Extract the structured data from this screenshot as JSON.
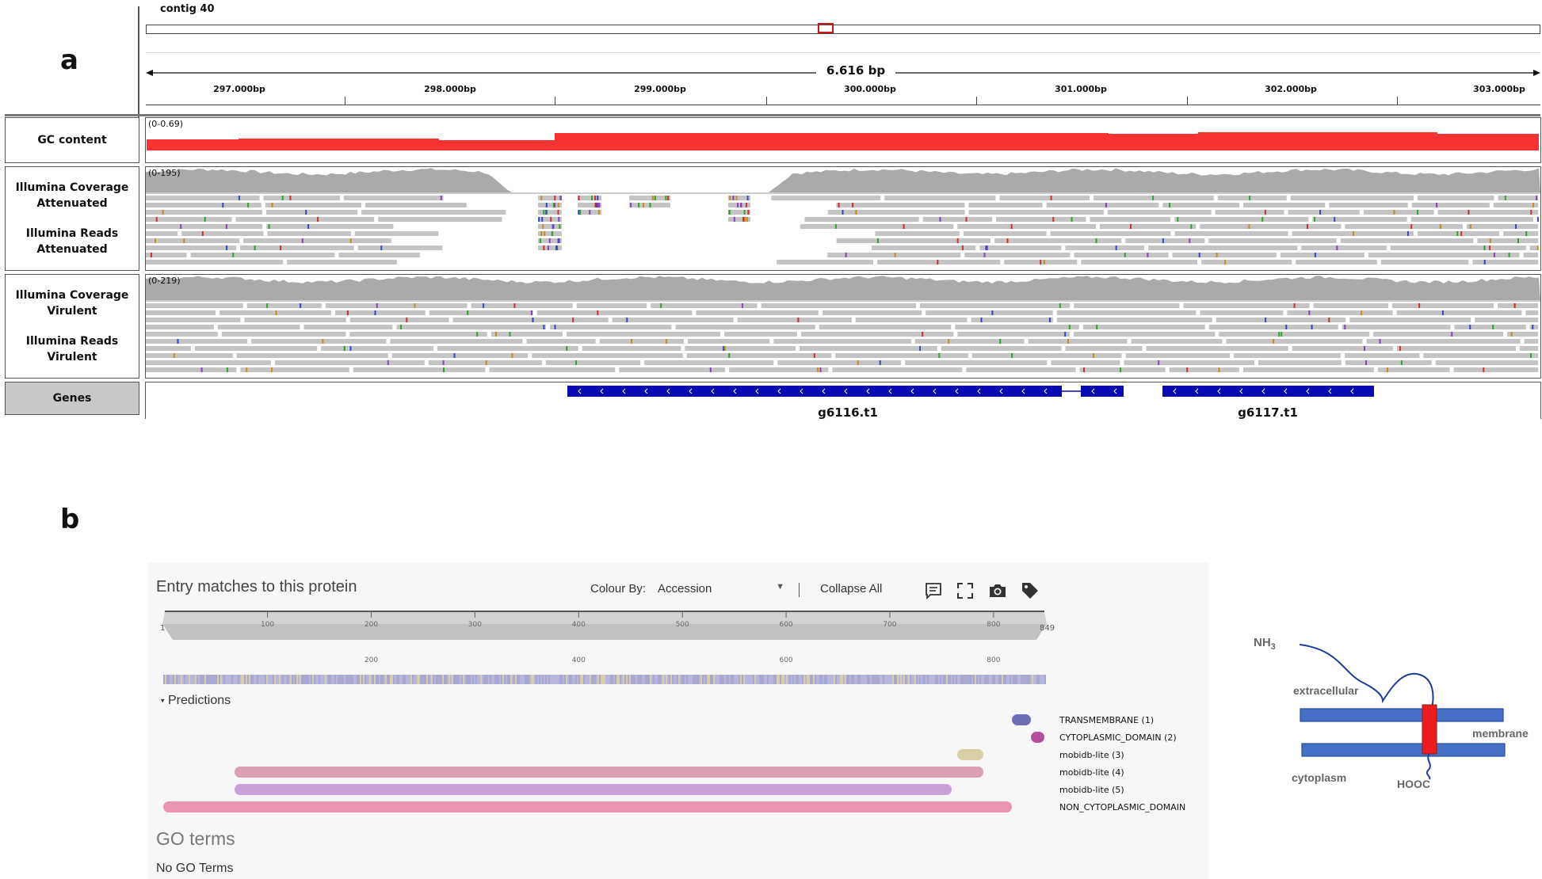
{
  "panel_a": {
    "letter": "a",
    "contig": "contig 40",
    "span": "6.616 bp",
    "ticks": [
      "297.000bp",
      "298.000bp",
      "299.000bp",
      "300.000bp",
      "301.000bp",
      "302.000bp",
      "303.000bp"
    ],
    "tracks": {
      "gc": {
        "label": "GC content",
        "range": "(0-0.69)"
      },
      "att_cov": {
        "label_line1": "Illumina Coverage",
        "label_line2": "Attenuated",
        "range": "(0-195)"
      },
      "att_reads": {
        "label_line1": "Illumina Reads",
        "label_line2": "Attenuated"
      },
      "vir_cov": {
        "label_line1": "Illumina Coverage",
        "label_line2": "Virulent",
        "range": "(0-219)"
      },
      "vir_reads": {
        "label_line1": "Illumina Reads",
        "label_line2": "Virulent"
      },
      "genes": {
        "label": "Genes",
        "gene1": "g6116.t1",
        "gene2": "g6117.t1"
      }
    },
    "colors": {
      "gc": "#f53333",
      "coverage": "#aaaaaa",
      "reads": "#c4c4c4",
      "gene": "#0a0ab4",
      "locator": "#d01515"
    }
  },
  "panel_b": {
    "letter": "b",
    "interpro": {
      "title": "Entry matches to this protein",
      "colour_by_label": "Colour By:",
      "colour_by_value": "Accession",
      "collapse_all": "Collapse All",
      "icons": [
        "comment-icon",
        "fullscreen-icon",
        "camera-icon",
        "tag-icon"
      ],
      "ruler_ticks": [
        "100",
        "200",
        "300",
        "400",
        "500",
        "600",
        "700",
        "800"
      ],
      "ruler_start": "1",
      "ruler_end": "849",
      "scale_ticks": [
        "200",
        "400",
        "600",
        "800"
      ],
      "section": "Predictions",
      "predictions": [
        {
          "label": "TRANSMEMBRANE (1)",
          "start": 818,
          "end": 836,
          "color": "#6e6db8"
        },
        {
          "label": "CYTOPLASMIC_DOMAIN (2)",
          "start": 836,
          "end": 849,
          "color": "#b4509e"
        },
        {
          "label": "mobidb-lite (3)",
          "start": 765,
          "end": 790,
          "color": "#d9cfa6"
        },
        {
          "label": "mobidb-lite (4)",
          "start": 70,
          "end": 790,
          "color": "#d9a1b2"
        },
        {
          "label": "mobidb-lite (5)",
          "start": 70,
          "end": 760,
          "color": "#c9a2dc"
        },
        {
          "label": "NON_CYTOPLASMIC_DOMAIN",
          "start": 1,
          "end": 818,
          "color": "#e995b0"
        }
      ],
      "go_title": "GO terms",
      "go_value": "No GO Terms"
    },
    "topology": {
      "nh3": "NH",
      "nh3_sub": "3",
      "extracellular": "extracellular",
      "membrane": "membrane",
      "cytoplasm": "cytoplasm",
      "hooc": "HOOC"
    }
  }
}
